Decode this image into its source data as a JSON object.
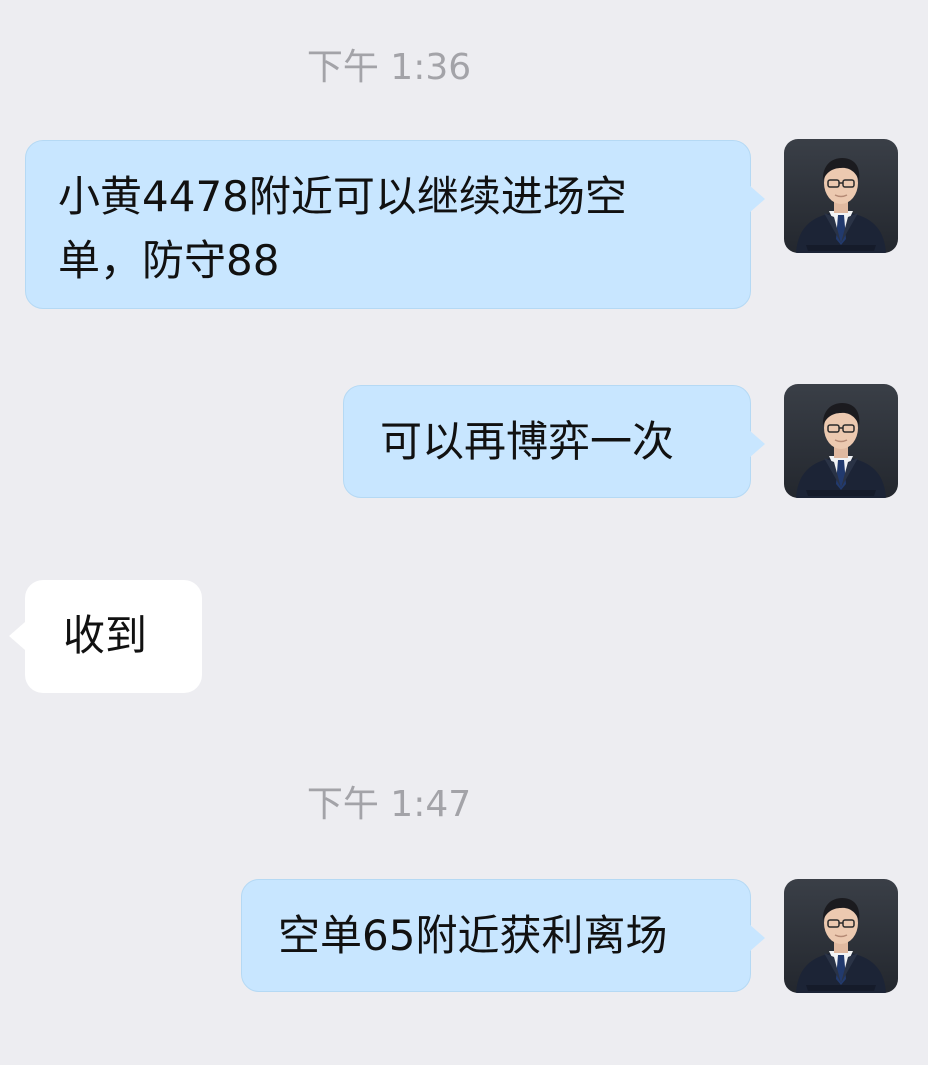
{
  "messages": [
    {
      "type": "timestamp",
      "text": "下午 1:36"
    },
    {
      "type": "message",
      "direction": "sent",
      "text": "小黄4478附近可以继续进场空\n单，防守88",
      "avatar": "avatar-icon"
    },
    {
      "type": "message",
      "direction": "sent",
      "text": "可以再博弈一次",
      "avatar": "avatar-icon"
    },
    {
      "type": "message",
      "direction": "received",
      "text": "收到"
    },
    {
      "type": "timestamp",
      "text": "下午 1:47"
    },
    {
      "type": "message",
      "direction": "sent",
      "text": "空单65附近获利离场",
      "avatar": "avatar-icon"
    }
  ],
  "colors": {
    "background": "#ededf1",
    "sent_bubble": "#c8e6ff",
    "received_bubble": "#ffffff",
    "timestamp_text": "#a3a3a8"
  }
}
